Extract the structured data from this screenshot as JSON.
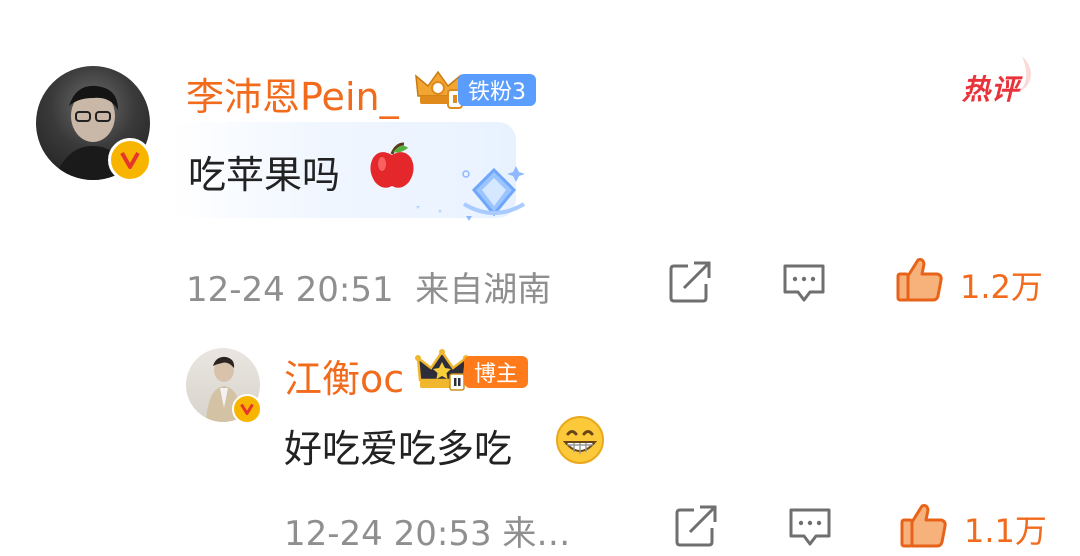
{
  "comments": [
    {
      "username": "李沛恩Pein_",
      "fan_badge": "铁粉3",
      "hot_label": "热评",
      "text": "吃苹果吗",
      "emoji": "apple",
      "timestamp": "12-24 20:51",
      "location": "来自湖南",
      "likes": "1.2万",
      "badge_color": "#5b9dfd"
    },
    {
      "username": "江衡oc",
      "role_badge": "博主",
      "text": "好吃爱吃多吃",
      "emoji": "grinning-face",
      "timestamp_location": "12-24 20:53  来…",
      "likes": "1.1万",
      "badge_color": "#ff7a1a"
    }
  ]
}
